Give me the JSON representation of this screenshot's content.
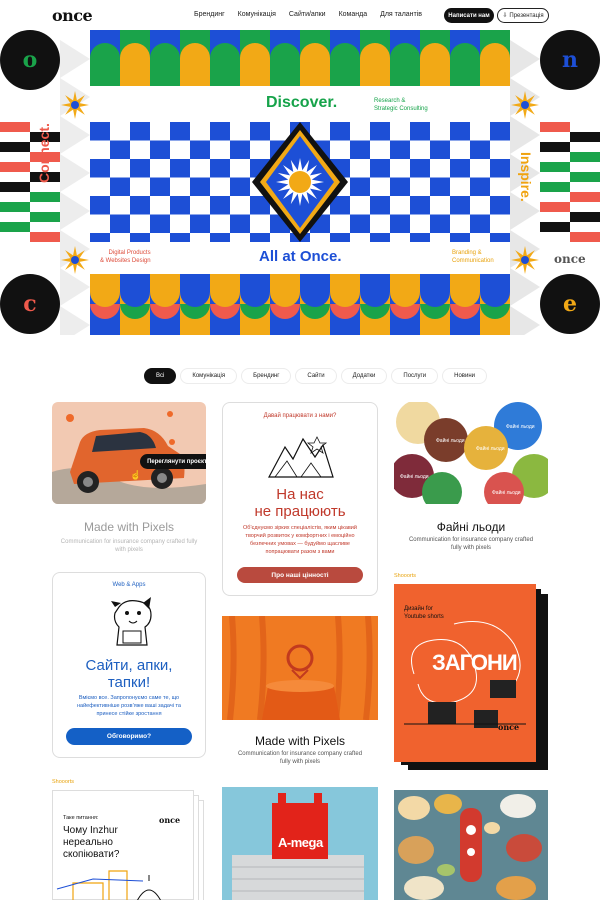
{
  "header": {
    "logo": "once",
    "nav": [
      "Брендинг",
      "Комунікація",
      "Сайти/апки",
      "Команда",
      "Для талантів"
    ],
    "cta_primary": "Написати нам",
    "cta_secondary": "Презентація"
  },
  "hero": {
    "discover": "Discover.",
    "research_line1": "Research &",
    "research_line2": "Strategic Consulting",
    "all_at_once": "All at Once.",
    "connect": "Connect.",
    "inspire": "Inspire.",
    "digital_line1": "Digital Products",
    "digital_line2": "& Websites Design",
    "branding_line1": "Branding &",
    "branding_line2": "Communication",
    "once_small": "once",
    "letters": [
      "o",
      "n",
      "c",
      "e"
    ]
  },
  "filters": [
    "Всі",
    "Комунікація",
    "Брендинг",
    "Сайти",
    "Додатки",
    "Послуги",
    "Новини"
  ],
  "cards": {
    "pixels1": {
      "tooltip": "Переглянути проєкт",
      "title": "Made with Pixels",
      "sub_line1": "Communication for insurance company crafted fully",
      "sub_line2": "with pixels"
    },
    "invite": {
      "top": "Давай працювати з нами?",
      "headline1": "На нас",
      "headline2": "не працюють",
      "body1": "Об'єднуємо зірких спеціалістів, яким цікавий",
      "body2": "творчий розвиток у комфортних і емоційно",
      "body3": "безпечних умовах — будуймо щасливе",
      "body4": "попрацювати разом з вами",
      "button": "Про наші цінності"
    },
    "ice": {
      "title": "Файні льоди",
      "sub_line1": "Communication for insurance company crafted",
      "sub_line2": "fully with pixels",
      "scoop_text": "Файні льоди"
    },
    "web": {
      "tag": "Web & Apps",
      "headline1": "Сайти, апки,",
      "headline2": "тапки!",
      "body1": "Вміємо все. Запропонуємо саме те, що",
      "body2": "найефективніше розвʼяже ваші задачі та",
      "body3": "принесе стійке зростання",
      "button": "Обговоримо?"
    },
    "pixels2": {
      "title": "Made with Pixels",
      "sub_line1": "Communication for insurance company crafted",
      "sub_line2": "fully with pixels"
    },
    "shooorts1": {
      "tag": "Shooorts",
      "design1": "Дизайн for",
      "design2": "Youtube shorts",
      "big": "ЗАГОНИ",
      "logo": "once"
    },
    "shooorts2": {
      "tag": "Shooorts",
      "topic": "Таке питання:",
      "logo": "once",
      "q1": "Чому Inzhur",
      "q2": "нереально",
      "q3": "скопіювати?"
    },
    "amega": {
      "sign": "A-mega"
    }
  },
  "colors": {
    "blue": "#1d4fd6",
    "green": "#1aa34a",
    "yellow": "#f2a916",
    "red": "#ef5a4c",
    "orange": "#f15a24",
    "dark": "#111111"
  }
}
